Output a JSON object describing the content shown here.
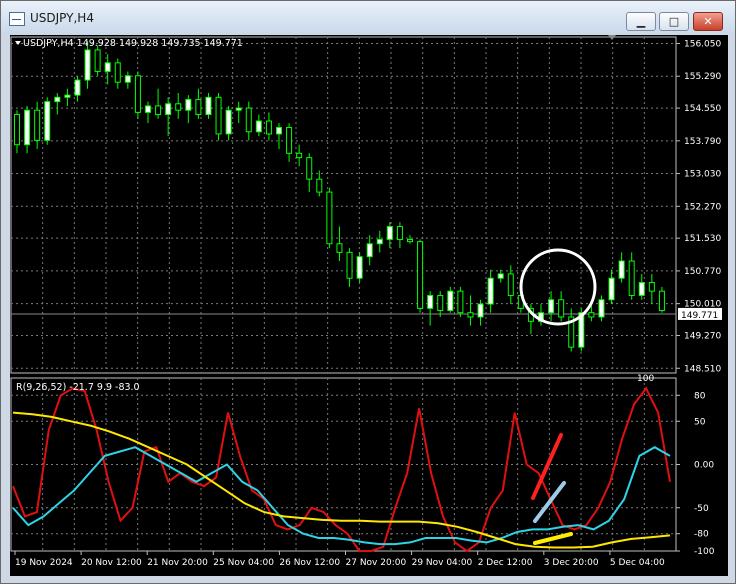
{
  "window": {
    "title": "USDJPY,H4",
    "min_label": "▁",
    "max_label": "□",
    "close_label": "✕"
  },
  "main_panel": {
    "info": "USDJPY,H4  149.928 149.928 149.735 149.771",
    "price_ticks": [
      "156.050",
      "155.290",
      "154.550",
      "153.790",
      "153.030",
      "152.270",
      "151.530",
      "150.770",
      "150.010",
      "149.270",
      "148.510"
    ],
    "price_values": [
      156.05,
      155.29,
      154.55,
      153.79,
      153.03,
      152.27,
      151.53,
      150.77,
      150.01,
      149.27,
      148.51
    ],
    "current_price": "149.771",
    "current_price_value": 149.771
  },
  "indicator_panel": {
    "info": "R(9,26,52) -21.7 9.9 -83.0",
    "ticks": [
      "80",
      "50",
      "0.00",
      "-50",
      "-80",
      "-100"
    ],
    "tick_values": [
      80,
      50,
      0,
      -50,
      -80,
      -100
    ],
    "top_value": "100",
    "bottom_value": "-100"
  },
  "time_axis": [
    "19 Nov 2024",
    "20 Nov 12:00",
    "21 Nov 20:00",
    "25 Nov 04:00",
    "26 Nov 12:00",
    "27 Nov 20:00",
    "29 Nov 04:00",
    "2 Dec 12:00",
    "3 Dec 20:00",
    "5 Dec 04:00"
  ],
  "colors": {
    "background": "#000000",
    "grid": "#7a7a7a",
    "candle_up": "#ffffff",
    "candle_wick": "#00ff00",
    "line_red": "#e01010",
    "line_cyan": "#2ed3e6",
    "line_yellow": "#ffe800",
    "annot_circle": "#ffffff",
    "annot_red": "#ff2020",
    "annot_blue": "#9ecbe8",
    "annot_yellow": "#ffee00"
  },
  "chart_data": {
    "type": "candlestick",
    "symbol": "USDJPY",
    "timeframe": "H4",
    "ylim": [
      148.4,
      156.2
    ],
    "candles": [
      {
        "o": 154.4,
        "h": 154.5,
        "l": 153.5,
        "c": 153.7
      },
      {
        "o": 153.7,
        "h": 154.6,
        "l": 153.5,
        "c": 154.5
      },
      {
        "o": 154.5,
        "h": 154.7,
        "l": 153.6,
        "c": 153.8
      },
      {
        "o": 153.8,
        "h": 154.8,
        "l": 153.7,
        "c": 154.7
      },
      {
        "o": 154.7,
        "h": 154.9,
        "l": 154.4,
        "c": 154.8
      },
      {
        "o": 154.8,
        "h": 155.0,
        "l": 154.6,
        "c": 154.85
      },
      {
        "o": 154.85,
        "h": 155.3,
        "l": 154.7,
        "c": 155.2
      },
      {
        "o": 155.2,
        "h": 156.1,
        "l": 155.0,
        "c": 155.9
      },
      {
        "o": 155.9,
        "h": 156.0,
        "l": 155.3,
        "c": 155.4
      },
      {
        "o": 155.4,
        "h": 155.8,
        "l": 155.1,
        "c": 155.6
      },
      {
        "o": 155.6,
        "h": 155.7,
        "l": 155.0,
        "c": 155.15
      },
      {
        "o": 155.15,
        "h": 155.4,
        "l": 155.0,
        "c": 155.3
      },
      {
        "o": 155.3,
        "h": 155.4,
        "l": 154.3,
        "c": 154.45
      },
      {
        "o": 154.45,
        "h": 154.7,
        "l": 154.2,
        "c": 154.6
      },
      {
        "o": 154.6,
        "h": 155.0,
        "l": 154.3,
        "c": 154.4
      },
      {
        "o": 154.4,
        "h": 154.8,
        "l": 153.9,
        "c": 154.65
      },
      {
        "o": 154.65,
        "h": 154.9,
        "l": 154.3,
        "c": 154.5
      },
      {
        "o": 154.5,
        "h": 154.85,
        "l": 154.2,
        "c": 154.75
      },
      {
        "o": 154.75,
        "h": 155.0,
        "l": 154.3,
        "c": 154.4
      },
      {
        "o": 154.4,
        "h": 154.9,
        "l": 154.3,
        "c": 154.8
      },
      {
        "o": 154.8,
        "h": 154.9,
        "l": 153.8,
        "c": 153.95
      },
      {
        "o": 153.95,
        "h": 154.6,
        "l": 153.8,
        "c": 154.5
      },
      {
        "o": 154.5,
        "h": 154.7,
        "l": 154.2,
        "c": 154.55
      },
      {
        "o": 154.55,
        "h": 154.7,
        "l": 153.8,
        "c": 154.0
      },
      {
        "o": 154.0,
        "h": 154.4,
        "l": 153.9,
        "c": 154.25
      },
      {
        "o": 154.25,
        "h": 154.45,
        "l": 153.8,
        "c": 153.95
      },
      {
        "o": 153.95,
        "h": 154.2,
        "l": 153.6,
        "c": 154.1
      },
      {
        "o": 154.1,
        "h": 154.2,
        "l": 153.3,
        "c": 153.5
      },
      {
        "o": 153.5,
        "h": 153.7,
        "l": 153.2,
        "c": 153.4
      },
      {
        "o": 153.4,
        "h": 153.5,
        "l": 152.6,
        "c": 152.9
      },
      {
        "o": 152.9,
        "h": 153.1,
        "l": 152.5,
        "c": 152.6
      },
      {
        "o": 152.6,
        "h": 152.7,
        "l": 151.3,
        "c": 151.4
      },
      {
        "o": 151.4,
        "h": 151.8,
        "l": 151.0,
        "c": 151.2
      },
      {
        "o": 151.2,
        "h": 151.3,
        "l": 150.4,
        "c": 150.6
      },
      {
        "o": 150.6,
        "h": 151.2,
        "l": 150.5,
        "c": 151.1
      },
      {
        "o": 151.1,
        "h": 151.6,
        "l": 150.9,
        "c": 151.4
      },
      {
        "o": 151.4,
        "h": 151.7,
        "l": 151.2,
        "c": 151.5
      },
      {
        "o": 151.5,
        "h": 151.9,
        "l": 151.3,
        "c": 151.8
      },
      {
        "o": 151.8,
        "h": 151.9,
        "l": 151.3,
        "c": 151.5
      },
      {
        "o": 151.5,
        "h": 151.6,
        "l": 151.4,
        "c": 151.45
      },
      {
        "o": 151.45,
        "h": 151.5,
        "l": 149.8,
        "c": 149.9
      },
      {
        "o": 149.9,
        "h": 150.3,
        "l": 149.5,
        "c": 150.2
      },
      {
        "o": 150.2,
        "h": 150.3,
        "l": 149.7,
        "c": 149.85
      },
      {
        "o": 149.85,
        "h": 150.4,
        "l": 149.8,
        "c": 150.3
      },
      {
        "o": 150.3,
        "h": 150.4,
        "l": 149.7,
        "c": 149.8
      },
      {
        "o": 149.8,
        "h": 150.2,
        "l": 149.5,
        "c": 149.7
      },
      {
        "o": 149.7,
        "h": 150.1,
        "l": 149.5,
        "c": 150.0
      },
      {
        "o": 150.0,
        "h": 150.8,
        "l": 149.8,
        "c": 150.6
      },
      {
        "o": 150.6,
        "h": 150.8,
        "l": 150.5,
        "c": 150.7
      },
      {
        "o": 150.7,
        "h": 150.9,
        "l": 150.0,
        "c": 150.2
      },
      {
        "o": 150.2,
        "h": 150.3,
        "l": 149.8,
        "c": 149.9
      },
      {
        "o": 149.9,
        "h": 150.0,
        "l": 149.3,
        "c": 149.6
      },
      {
        "o": 149.6,
        "h": 150.0,
        "l": 149.5,
        "c": 149.8
      },
      {
        "o": 149.8,
        "h": 150.3,
        "l": 149.6,
        "c": 150.1
      },
      {
        "o": 150.1,
        "h": 150.3,
        "l": 149.6,
        "c": 149.7
      },
      {
        "o": 149.7,
        "h": 149.9,
        "l": 148.9,
        "c": 149.0
      },
      {
        "o": 149.0,
        "h": 149.9,
        "l": 148.9,
        "c": 149.8
      },
      {
        "o": 149.8,
        "h": 150.1,
        "l": 149.6,
        "c": 149.7
      },
      {
        "o": 149.7,
        "h": 150.2,
        "l": 149.6,
        "c": 150.1
      },
      {
        "o": 150.1,
        "h": 150.8,
        "l": 150.0,
        "c": 150.6
      },
      {
        "o": 150.6,
        "h": 151.2,
        "l": 150.5,
        "c": 151.0
      },
      {
        "o": 151.0,
        "h": 151.2,
        "l": 150.1,
        "c": 150.2
      },
      {
        "o": 150.2,
        "h": 150.7,
        "l": 150.1,
        "c": 150.5
      },
      {
        "o": 150.5,
        "h": 150.7,
        "l": 150.0,
        "c": 150.3
      },
      {
        "o": 150.3,
        "h": 150.4,
        "l": 149.8,
        "c": 149.85
      }
    ],
    "indicator": {
      "name": "R(9,26,52)",
      "ylim": [
        -100,
        100
      ],
      "series": [
        {
          "name": "R 9",
          "color": "line_red",
          "values": [
            -25,
            -60,
            -55,
            40,
            80,
            88,
            85,
            40,
            -20,
            -65,
            -50,
            15,
            20,
            -20,
            -10,
            -20,
            -25,
            -15,
            60,
            10,
            -30,
            -40,
            -70,
            -75,
            -70,
            -50,
            -55,
            -70,
            -80,
            -100,
            -100,
            -95,
            -50,
            -10,
            65,
            -10,
            -60,
            -90,
            -100,
            -90,
            -50,
            -30,
            60,
            0,
            -10,
            -40,
            -70,
            -75,
            -70,
            -50,
            -20,
            30,
            70,
            88,
            60,
            -20
          ]
        },
        {
          "name": "R 26",
          "color": "line_cyan",
          "values": [
            -50,
            -70,
            -60,
            -45,
            -30,
            -10,
            10,
            15,
            20,
            10,
            0,
            -10,
            -20,
            -10,
            0,
            -20,
            -30,
            -50,
            -70,
            -80,
            -85,
            -85,
            -87,
            -90,
            -92,
            -92,
            -90,
            -85,
            -85,
            -85,
            -88,
            -90,
            -85,
            -78,
            -75,
            -75,
            -72,
            -70,
            -75,
            -65,
            -40,
            10,
            20,
            10
          ]
        },
        {
          "name": "R 52",
          "color": "line_yellow",
          "values": [
            60,
            58,
            55,
            50,
            45,
            38,
            30,
            20,
            10,
            0,
            -15,
            -30,
            -45,
            -55,
            -60,
            -62,
            -64,
            -65,
            -65,
            -66,
            -66,
            -66,
            -68,
            -72,
            -78,
            -85,
            -92,
            -95,
            -96,
            -96,
            -95,
            -90,
            -86,
            -84,
            -82
          ]
        }
      ]
    }
  }
}
